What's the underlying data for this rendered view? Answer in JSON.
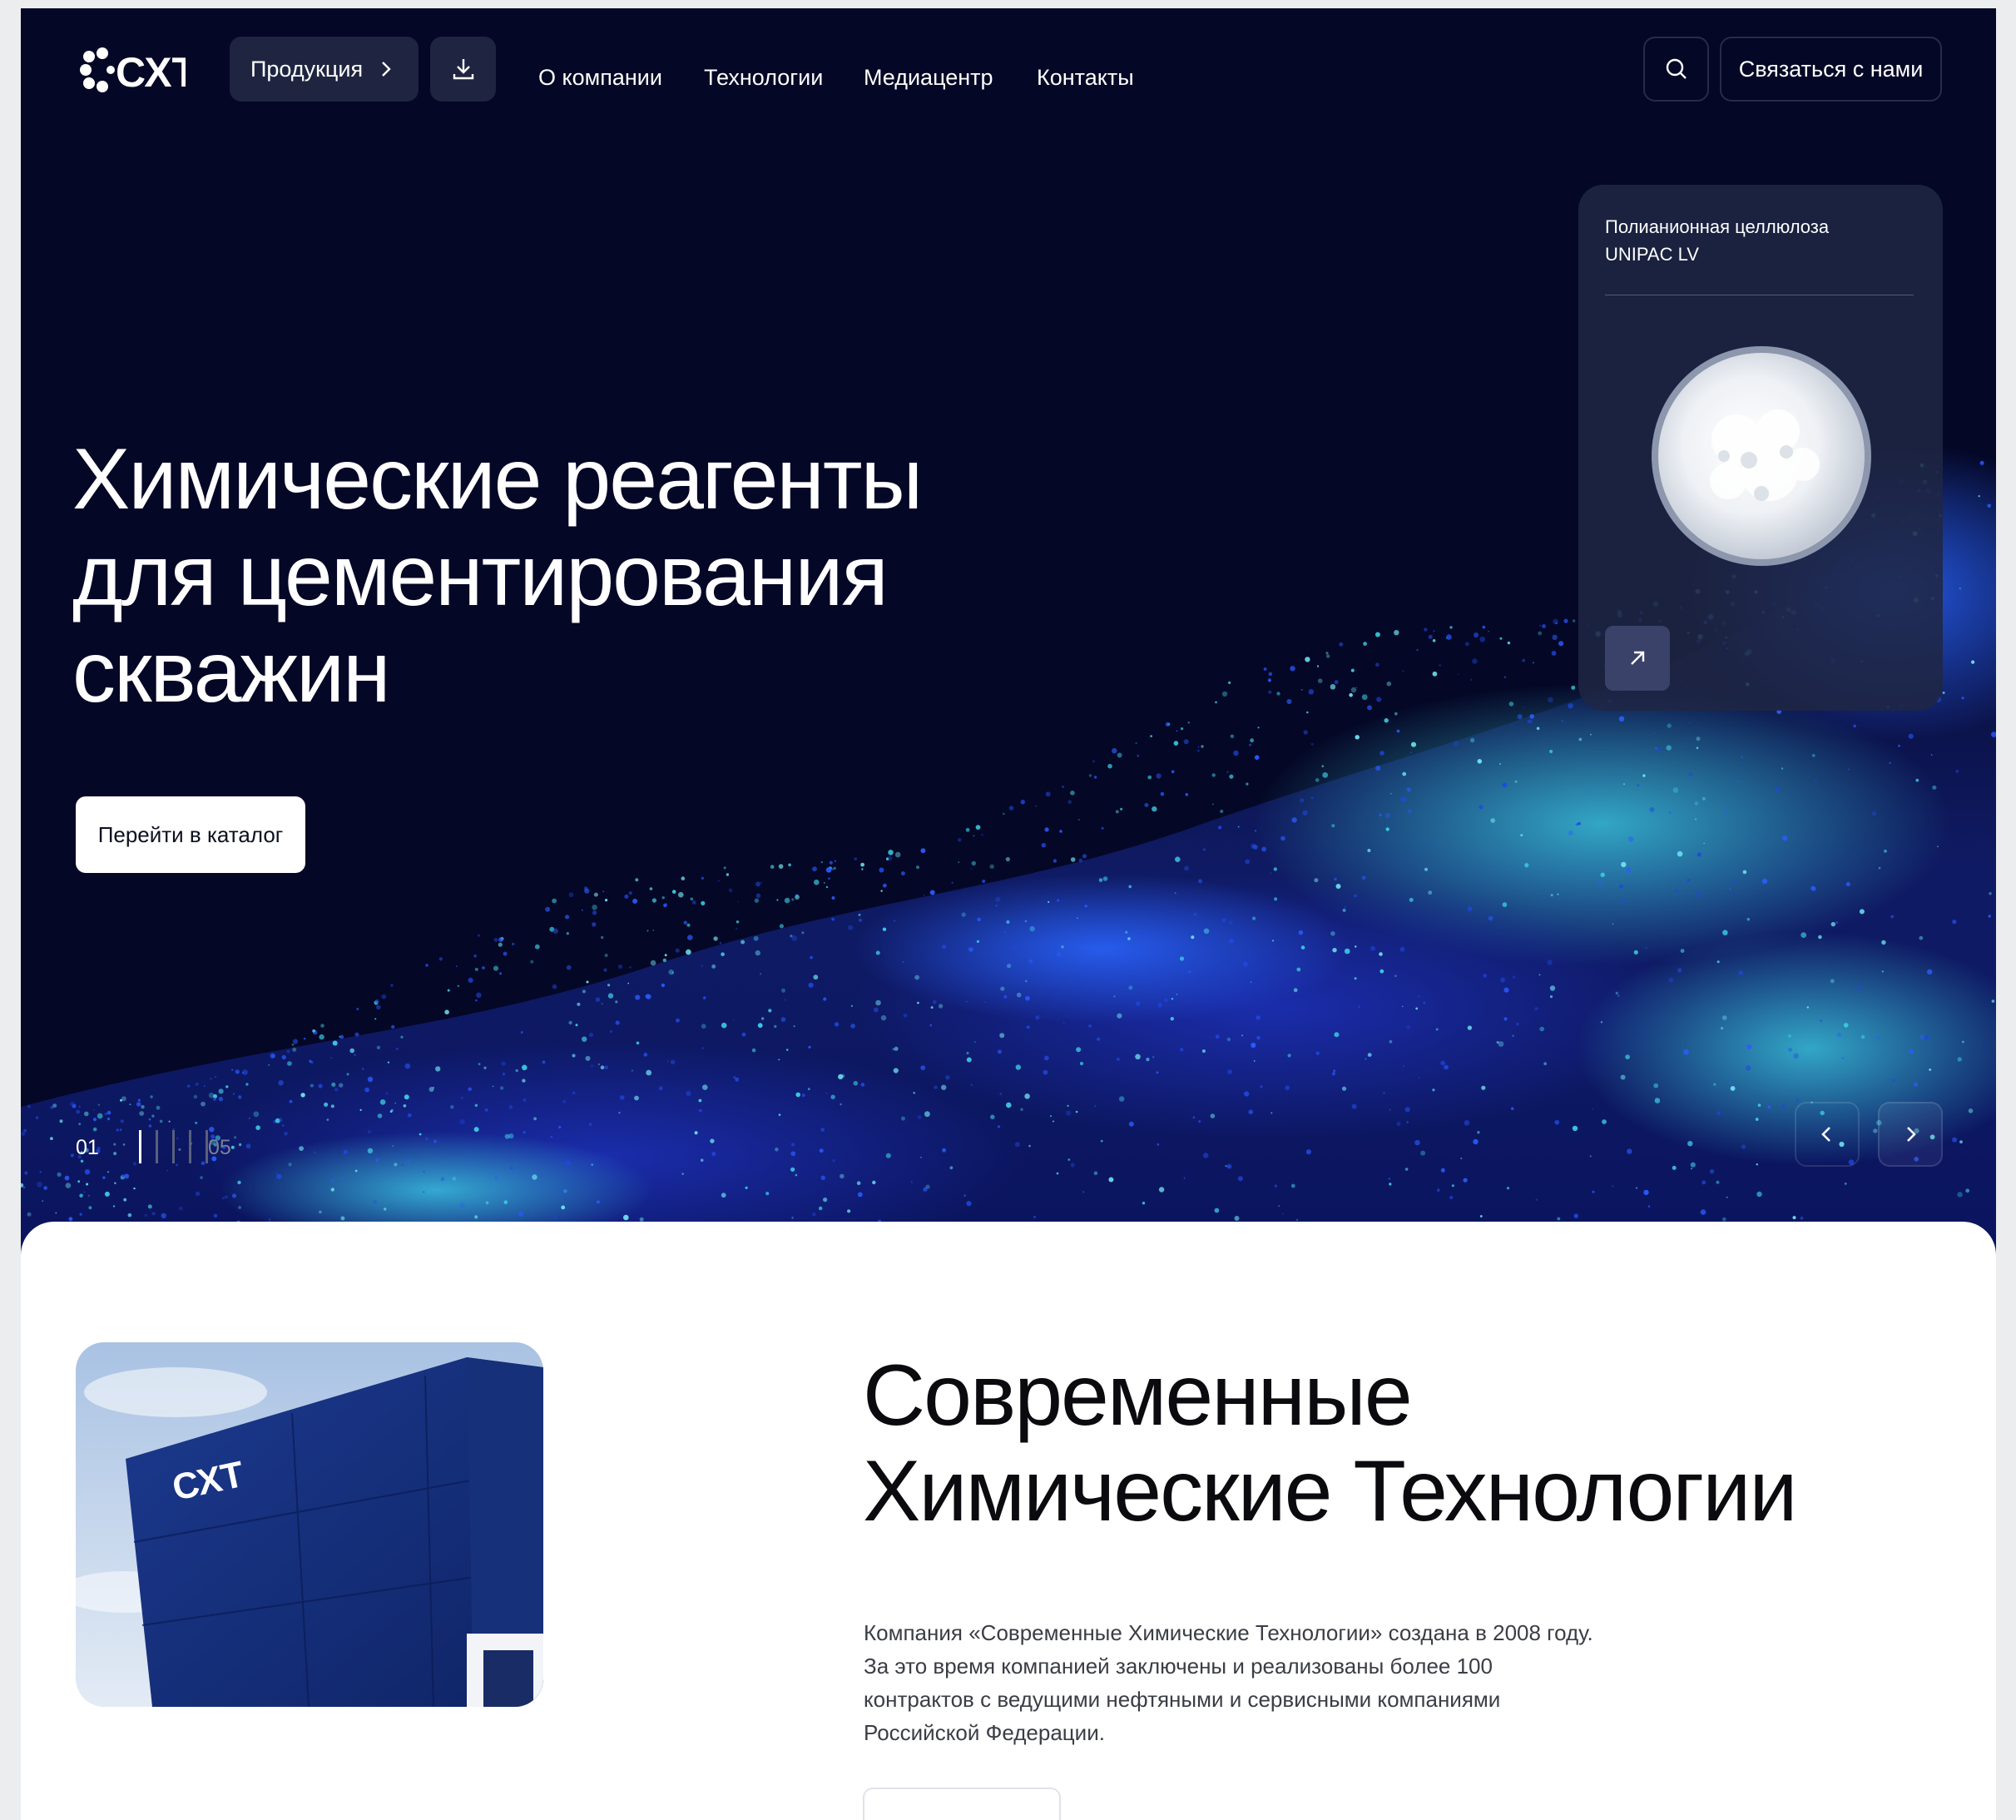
{
  "nav": {
    "logo_text": "СХТ",
    "products_label": "Продукция",
    "links": [
      "О компании",
      "Технологии",
      "Медиацентр",
      "Контакты"
    ],
    "contact_label": "Связаться с нами",
    "icons": {
      "products": "chevron-right-icon",
      "download": "download-icon",
      "search": "search-icon"
    }
  },
  "hero": {
    "title": "Химические реагенты\nдля цементирования\nскважин",
    "cta_label": "Перейти в каталог",
    "slider": {
      "current": "01",
      "total": "05",
      "active_index": 0,
      "count": 5
    }
  },
  "product_card": {
    "title": "Полианионная целлюлоза\nUNIPAC LV",
    "icon": "arrow-up-right-icon"
  },
  "about": {
    "title": "Современные\nХимические Технологии",
    "text": "Компания «Современные Химические Технологии» создана в 2008 году.\nЗа это время компанией заключены и реализованы более 100\nконтрактов с ведущими нефтяными и сервисными компаниями\nРоссийской Федерации.",
    "building_sign": "СХТ"
  },
  "colors": {
    "hero_bg": "#040726",
    "particles_blue": "#1f48e0",
    "particles_cyan": "#3fd0e4",
    "card_bg": "#202644"
  }
}
